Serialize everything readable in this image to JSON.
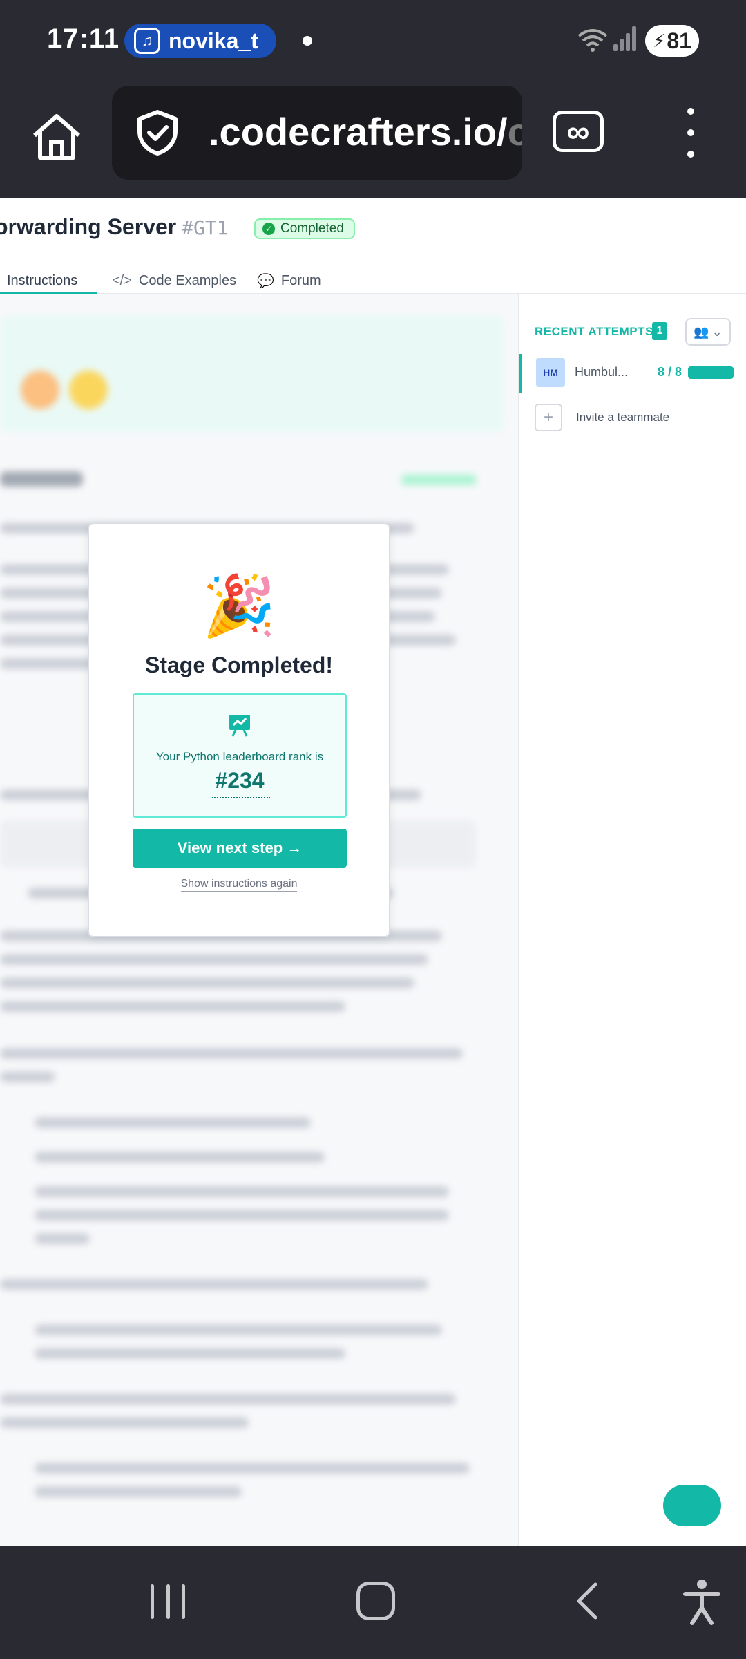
{
  "status_bar": {
    "time": "17:11",
    "notification_pill": "novika_t",
    "battery": "81"
  },
  "browser": {
    "url_visible": ".codecrafters.io/",
    "url_fade": "c"
  },
  "header": {
    "title": "orwarding Server",
    "stage_code": "#GT1",
    "status_badge": "Completed",
    "tabs": [
      {
        "label": "Instructions",
        "icon": "book-icon"
      },
      {
        "label": "Code Examples",
        "icon": "code-icon"
      },
      {
        "label": "Forum",
        "icon": "chat-icon"
      }
    ]
  },
  "modal": {
    "emoji": "🎉",
    "title": "Stage Completed!",
    "rank_text": "Your Python leaderboard rank is",
    "rank_value": "#234",
    "next_button": "View next step →",
    "show_again": "Show instructions again"
  },
  "sidebar": {
    "recent_attempts_label": "RECENT ATTEMPTS",
    "recent_attempts_count": "1",
    "attempt": {
      "avatar": "HM",
      "name": "Humbul...",
      "score": "8 / 8",
      "progress": 1.0
    },
    "invite_label": "Invite a teammate"
  },
  "colors": {
    "accent": "#14b8a6",
    "chrome": "#2a2a33",
    "success": "#16a34a"
  }
}
